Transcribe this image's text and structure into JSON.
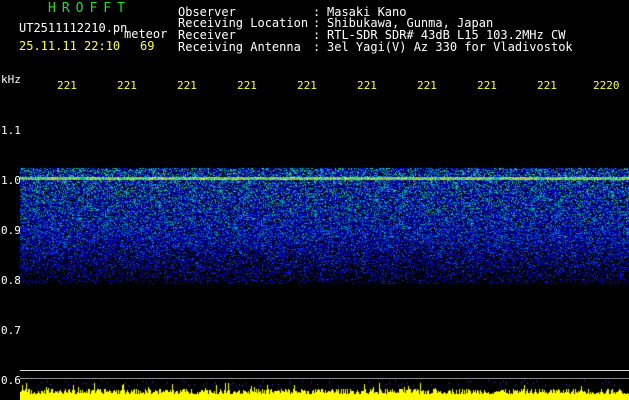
{
  "header": {
    "app_title": "HROFFT",
    "file_name": "UT2511112210.pn",
    "mode": "meteor",
    "datetime": "25.11.11 22:10",
    "count": "69",
    "info": [
      {
        "key": "Observer",
        "sep": ":",
        "value": "Masaki Kano"
      },
      {
        "key": "Receiving Location",
        "sep": ":",
        "value": "Shibukawa, Gunma, Japan"
      },
      {
        "key": "Receiver",
        "sep": ":",
        "value": "RTL-SDR SDR# 43dB L15 103.2MHz CW"
      },
      {
        "key": "Receiving Antenna",
        "sep": ":",
        "value": "3el Yagi(V) Az 330 for Vladivostok"
      }
    ]
  },
  "colors": {
    "background": "#000000",
    "text_info": "#ffffff",
    "text_time": "#ffff33",
    "text_title": "#22dd22",
    "signal_level": "#ffff00"
  },
  "axis": {
    "y_unit": "kHz",
    "y_ticks": [
      "1.1",
      "1.0",
      "0.9",
      "0.8",
      "0.7",
      "0.6"
    ],
    "x_ticks": [
      "221",
      "221",
      "221",
      "221",
      "221",
      "221",
      "221",
      "221",
      "221",
      "2220"
    ]
  },
  "chart_data": {
    "type": "heatmap",
    "title": "",
    "xlabel": "",
    "ylabel": "kHz",
    "y_unit": "kHz",
    "ylim": [
      0.58,
      1.16
    ],
    "x_ticks": [
      "221",
      "221",
      "221",
      "221",
      "221",
      "221",
      "221",
      "221",
      "221",
      "2220"
    ],
    "y_ticks": [
      1.1,
      1.0,
      0.9,
      0.8,
      0.7,
      0.6
    ],
    "carrier_frequency": 1.0,
    "noise_band": [
      0.8,
      1.02
    ],
    "level_strip": "yellow bars along bottom"
  }
}
